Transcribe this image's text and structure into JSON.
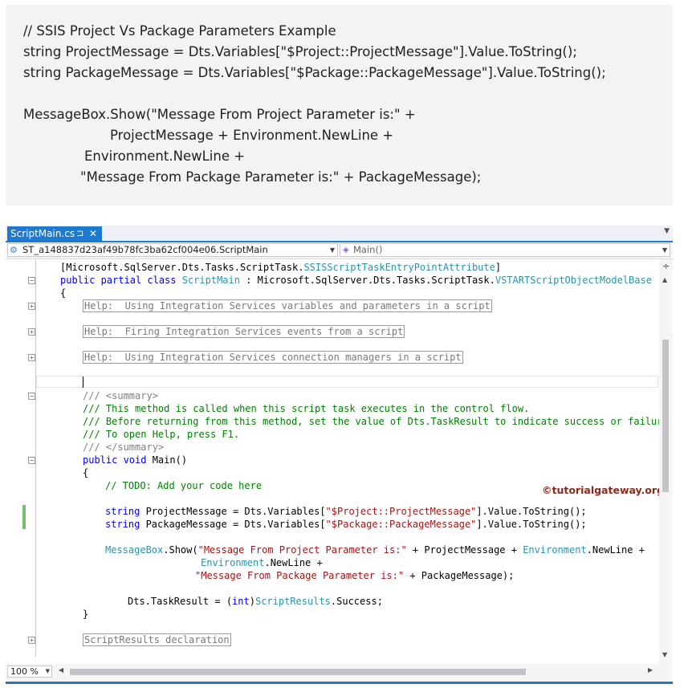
{
  "snippet": {
    "lines": [
      "// SSIS Project Vs Package Parameters Example",
      "string ProjectMessage = Dts.Variables[\"$Project::ProjectMessage\"].Value.ToString();",
      "string PackageMessage = Dts.Variables[\"$Package::PackageMessage\"].Value.ToString();",
      "MessageBox.Show(\"Message From Project Parameter is:\" +",
      "ProjectMessage + Environment.NewLine +",
      "Environment.NewLine +",
      "\"Message From Package Parameter is:\" + PackageMessage);"
    ]
  },
  "ide": {
    "tab_label": "ScriptMain.cs",
    "tab_pin": "⊐",
    "tab_close": "✕",
    "nav_class": "ST_a148837d23af49b78fc3ba62cf004e06.ScriptMain",
    "nav_member": "Main()",
    "zoom": "100 %",
    "watermark": "©tutorialgateway.org"
  },
  "code": {
    "l1a": "[Microsoft.SqlServer.Dts.Tasks.ScriptTask.",
    "l1b": "SSISScriptTaskEntryPointAttribute",
    "l1c": "]",
    "l2a": "public partial class ",
    "l2b": "ScriptMain",
    "l2c": " : Microsoft.SqlServer.Dts.Tasks.ScriptTask.",
    "l2d": "VSTARTScriptObjectModelBase",
    "l3": "{",
    "help1": "Help:  Using Integration Services variables and parameters in a script",
    "help2": "Help:  Firing Integration Services events from a script",
    "help3": "Help:  Using Integration Services connection managers in a script",
    "d1": "/// <summary>",
    "d2": "/// This method is called when this script task executes in the control flow.",
    "d3": "/// Before returning from this method, set the value of Dts.TaskResult to indicate success or failure.",
    "d4": "/// To open Help, press F1.",
    "d5": "/// </summary>",
    "m1a": "public void ",
    "m1b": "Main()",
    "m2": "{",
    "todo": "// TODO: Add your code here",
    "s1a": "string",
    "s1b": " ProjectMessage = Dts.Variables[",
    "s1c": "\"$Project::ProjectMessage\"",
    "s1d": "].Value.ToString();",
    "s2a": "string",
    "s2b": " PackageMessage = Dts.Variables[",
    "s2c": "\"$Package::PackageMessage\"",
    "s2d": "].Value.ToString();",
    "mb1a": "MessageBox",
    "mb1b": ".Show(",
    "mb1c": "\"Message From Project Parameter is:\"",
    "mb1d": " + ProjectMessage + ",
    "mb1e": "Environment",
    "mb1f": ".NewLine +",
    "mb2a": "Environment",
    "mb2b": ".NewLine +",
    "mb3a": "\"Message From Package Parameter is:\"",
    "mb3b": " + PackageMessage);",
    "r1a": "Dts.TaskResult = (",
    "r1b": "int",
    "r1c": ")",
    "r1d": "ScriptResults",
    "r1e": ".Success;",
    "close1": "}",
    "region": "ScriptResults declaration"
  }
}
